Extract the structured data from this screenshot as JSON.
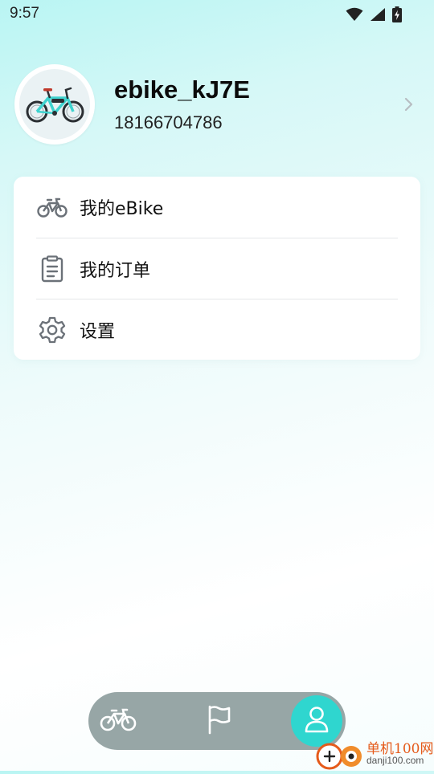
{
  "status_bar": {
    "time": "9:57",
    "icons": [
      "wifi-icon",
      "signal-icon",
      "battery-charging-icon"
    ]
  },
  "profile": {
    "avatar_icon": "bicycle-avatar",
    "username": "ebike_kJ7E",
    "phone": "18166704786"
  },
  "menu": {
    "items": [
      {
        "label": "我的eBike",
        "icon": "bicycle-icon"
      },
      {
        "label": "我的订单",
        "icon": "clipboard-icon"
      },
      {
        "label": "设置",
        "icon": "gear-icon"
      }
    ]
  },
  "bottom_nav": {
    "items": [
      {
        "icon": "bicycle-icon",
        "active": false
      },
      {
        "icon": "flag-icon",
        "active": false
      },
      {
        "icon": "user-icon",
        "active": true
      }
    ]
  },
  "watermark": {
    "line1": "单机100网",
    "line2": "danji100.com"
  },
  "colors": {
    "accent": "#2fd6cf",
    "nav_background": "#97a6a6",
    "icon_gray": "#6b7178",
    "watermark_orange": "#e55a1a"
  }
}
